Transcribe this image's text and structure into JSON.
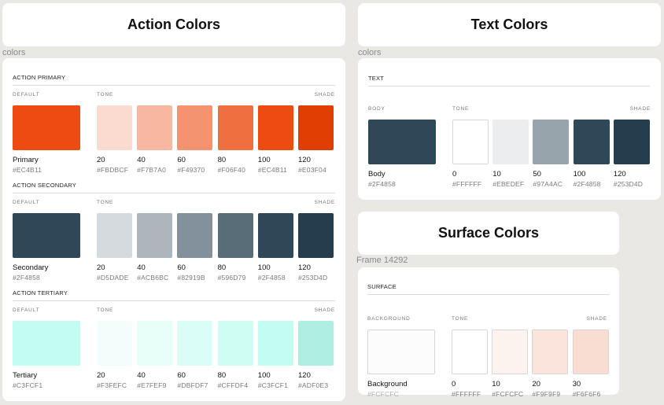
{
  "left_title": "Action Colors",
  "right_title": "Text Colors",
  "surface_title": "Surface Colors",
  "frame_labels": {
    "left": "colors",
    "right": "colors",
    "surface": "Frame 14292"
  },
  "action_groups": [
    {
      "title": "ACTION PRIMARY",
      "default_label": "DEFAULT",
      "tone_label": "TONE",
      "shade_label": "SHADE",
      "default": {
        "name": "Primary",
        "hex": "#EC4B11",
        "color": "#EC4B11"
      },
      "tones": [
        {
          "name": "20",
          "hex": "#FBDBCF",
          "color": "#FBDBCF"
        },
        {
          "name": "40",
          "hex": "#F7B7A0",
          "color": "#F7B7A0"
        },
        {
          "name": "60",
          "hex": "#F49370",
          "color": "#F49370"
        },
        {
          "name": "80",
          "hex": "#F06F40",
          "color": "#F06F40"
        },
        {
          "name": "100",
          "hex": "#EC4B11",
          "color": "#EC4B11"
        },
        {
          "name": "120",
          "hex": "#E03F04",
          "color": "#E03F04"
        }
      ]
    },
    {
      "title": "ACTION SECONDARY",
      "default_label": "DEFAULT",
      "tone_label": "TONE",
      "shade_label": "SHADE",
      "default": {
        "name": "Secondary",
        "hex": "#2F4858",
        "color": "#2F4858"
      },
      "tones": [
        {
          "name": "20",
          "hex": "#D5DADE",
          "color": "#D5DADE"
        },
        {
          "name": "40",
          "hex": "#ACB6BC",
          "color": "#ACB6BC"
        },
        {
          "name": "60",
          "hex": "#82919B",
          "color": "#82919B"
        },
        {
          "name": "80",
          "hex": "#596D79",
          "color": "#596D79"
        },
        {
          "name": "100",
          "hex": "#2F4858",
          "color": "#2F4858"
        },
        {
          "name": "120",
          "hex": "#253D4D",
          "color": "#253D4D"
        }
      ]
    },
    {
      "title": "ACTION TERTIARY",
      "default_label": "DEFAULT",
      "tone_label": "TONE",
      "shade_label": "SHADE",
      "default": {
        "name": "Tertiary",
        "hex": "#C3FCF1",
        "color": "#C3FCF1"
      },
      "tones": [
        {
          "name": "20",
          "hex": "#F3FEFC",
          "color": "#F3FEFC"
        },
        {
          "name": "40",
          "hex": "#E7FEF9",
          "color": "#E7FEF9"
        },
        {
          "name": "60",
          "hex": "#DBFDF7",
          "color": "#DBFDF7"
        },
        {
          "name": "80",
          "hex": "#CFFDF4",
          "color": "#CFFDF4"
        },
        {
          "name": "100",
          "hex": "#C3FCF1",
          "color": "#C3FCF1"
        },
        {
          "name": "120",
          "hex": "#ADF0E3",
          "color": "#ADF0E3"
        }
      ]
    }
  ],
  "text_group": {
    "title": "TEXT",
    "default_label": "BODY",
    "tone_label": "TONE",
    "shade_label": "SHADE",
    "default": {
      "name": "Body",
      "hex": "#2F4858",
      "color": "#2F4858"
    },
    "tones": [
      {
        "name": "0",
        "hex": "#FFFFFF",
        "color": "#FFFFFF"
      },
      {
        "name": "10",
        "hex": "#EBEDEF",
        "color": "#EBEDEF"
      },
      {
        "name": "50",
        "hex": "#97A4AC",
        "color": "#97A4AC"
      },
      {
        "name": "100",
        "hex": "#2F4858",
        "color": "#2F4858"
      },
      {
        "name": "120",
        "hex": "#253D4D",
        "color": "#253D4D"
      }
    ]
  },
  "surface_group": {
    "title": "SURFACE",
    "default_label": "BACKGROUND",
    "tone_label": "TONE",
    "shade_label": "SHADE",
    "default": {
      "name": "Background",
      "hex": "#FCFCFC",
      "color": "#FCFCFC"
    },
    "tones": [
      {
        "name": "0",
        "hex": "#FFFFFF",
        "color": "#FFFFFF"
      },
      {
        "name": "10",
        "hex": "#FCFCFC",
        "color": "#FCF2EE"
      },
      {
        "name": "20",
        "hex": "#F9F9F9",
        "color": "#FBE4DB"
      },
      {
        "name": "30",
        "hex": "#F6F6F6",
        "color": "#FADDD2"
      }
    ]
  }
}
